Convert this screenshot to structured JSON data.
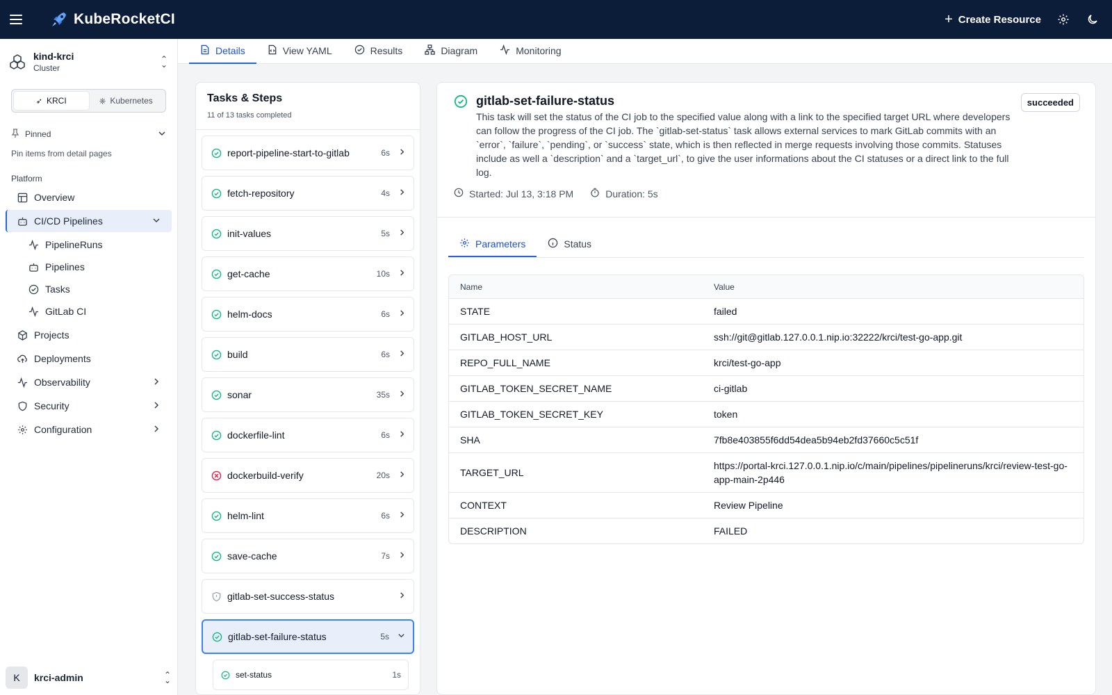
{
  "app": {
    "brand": "KubeRocketCI"
  },
  "topbar": {
    "create_label": "Create Resource",
    "menu_icon": "menu-icon",
    "settings_icon": "gear-icon",
    "theme_icon": "moon-icon"
  },
  "cluster": {
    "name": "kind-krci",
    "type": "Cluster"
  },
  "segment": {
    "krci": "KRCI",
    "kubernetes": "Kubernetes"
  },
  "pinned": {
    "label": "Pinned",
    "hint": "Pin items from detail pages"
  },
  "sidebar": {
    "section": "Platform",
    "overview": "Overview",
    "cicd": "CI/CD Pipelines",
    "sub": [
      "PipelineRuns",
      "Pipelines",
      "Tasks",
      "GitLab CI"
    ],
    "projects": "Projects",
    "deployments": "Deployments",
    "observability": "Observability",
    "security": "Security",
    "configuration": "Configuration"
  },
  "user": {
    "initial": "K",
    "name": "krci-admin"
  },
  "tabs": [
    "Details",
    "View YAML",
    "Results",
    "Diagram",
    "Monitoring"
  ],
  "tasks_panel": {
    "title": "Tasks & Steps",
    "subtitle": "11 of 13 tasks completed",
    "tasks": [
      {
        "name": "report-pipeline-start-to-gitlab",
        "duration": "6s",
        "status": "succeeded"
      },
      {
        "name": "fetch-repository",
        "duration": "4s",
        "status": "succeeded"
      },
      {
        "name": "init-values",
        "duration": "5s",
        "status": "succeeded"
      },
      {
        "name": "get-cache",
        "duration": "10s",
        "status": "succeeded"
      },
      {
        "name": "helm-docs",
        "duration": "6s",
        "status": "succeeded"
      },
      {
        "name": "build",
        "duration": "6s",
        "status": "succeeded"
      },
      {
        "name": "sonar",
        "duration": "35s",
        "status": "succeeded"
      },
      {
        "name": "dockerfile-lint",
        "duration": "6s",
        "status": "succeeded"
      },
      {
        "name": "dockerbuild-verify",
        "duration": "20s",
        "status": "failed"
      },
      {
        "name": "helm-lint",
        "duration": "6s",
        "status": "succeeded"
      },
      {
        "name": "save-cache",
        "duration": "7s",
        "status": "succeeded"
      },
      {
        "name": "gitlab-set-success-status",
        "duration": "",
        "status": "skipped"
      },
      {
        "name": "gitlab-set-failure-status",
        "duration": "5s",
        "status": "succeeded"
      }
    ],
    "step": {
      "name": "set-status",
      "duration": "1s"
    }
  },
  "detail": {
    "title": "gitlab-set-failure-status",
    "badge": "succeeded",
    "description": "This task will set the status of the CI job to the specified value along with a link to the specified target URL where developers can follow the progress of the CI job. The `gitlab-set-status` task allows external services to mark GitLab commits with an `error`, `failure`, `pending`, or `success` state, which is then reflected in merge requests involving those commits. Statuses include as well a `description` and a `target_url`, to give the user informations about the CI statuses or a direct link to the full log.",
    "started": "Started: Jul 13, 3:18 PM",
    "duration": "Duration: 5s",
    "tabs": [
      "Parameters",
      "Status"
    ],
    "table": {
      "headers": [
        "Name",
        "Value"
      ],
      "rows": [
        [
          "STATE",
          "failed"
        ],
        [
          "GITLAB_HOST_URL",
          "ssh://git@gitlab.127.0.0.1.nip.io:32222/krci/test-go-app.git"
        ],
        [
          "REPO_FULL_NAME",
          "krci/test-go-app"
        ],
        [
          "GITLAB_TOKEN_SECRET_NAME",
          "ci-gitlab"
        ],
        [
          "GITLAB_TOKEN_SECRET_KEY",
          "token"
        ],
        [
          "SHA",
          "7fb8e403855f6dd54dea5b94eb2fd37660c5c51f"
        ],
        [
          "TARGET_URL",
          "https://portal-krci.127.0.0.1.nip.io/c/main/pipelines/pipelineruns/krci/review-test-go-app-main-2p446"
        ],
        [
          "CONTEXT",
          "Review Pipeline"
        ],
        [
          "DESCRIPTION",
          "FAILED"
        ]
      ]
    }
  },
  "colors": {
    "topbar": "#0c1d3a",
    "accent": "#2563eb",
    "success": "#10b981",
    "error": "#e11d48"
  }
}
